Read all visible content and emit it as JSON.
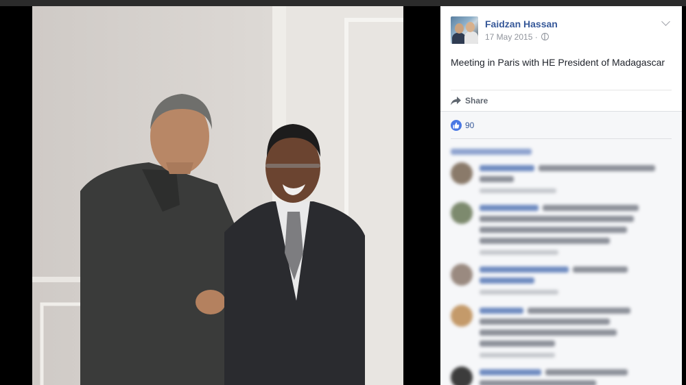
{
  "post": {
    "author": "Faidzan Hassan",
    "date": "17 May 2015",
    "date_separator": "·",
    "text": "Meeting in Paris with HE President of Madagascar",
    "share_label": "Share",
    "like_count": "90"
  },
  "icons": {
    "avatar": "profile-photo",
    "privacy": "globe-icon",
    "menu": "chevron-down-icon",
    "share": "share-arrow-icon",
    "like": "thumbs-up-icon"
  },
  "colors": {
    "link": "#365899",
    "like_badge": "#4a78e4",
    "panel_bg": "#ffffff",
    "comments_bg": "#f6f7f9"
  }
}
